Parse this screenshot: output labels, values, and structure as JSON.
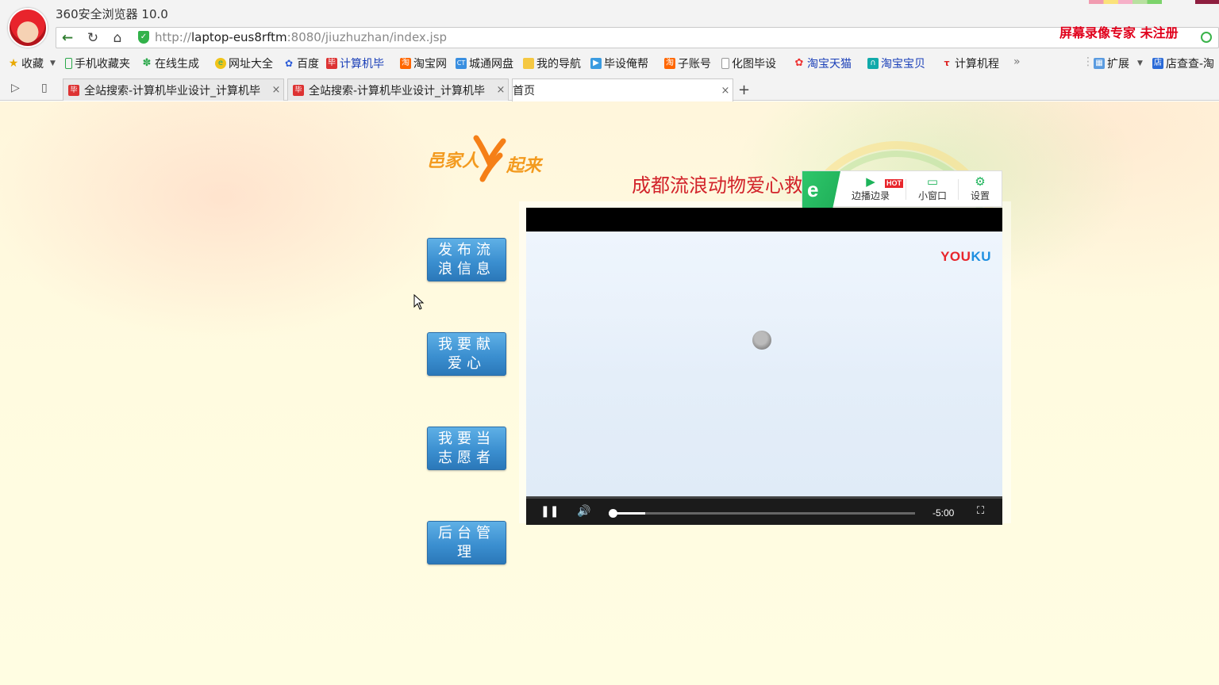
{
  "browser": {
    "app_title": "360安全浏览器 10.0",
    "url_prefix": "http://",
    "url_host": "laptop-eus8rftm",
    "url_path": ":8080/jiuzhuzhan/index.jsp",
    "recorder_text": "屏幕录像专家 未注册"
  },
  "bookmarks": [
    {
      "label": "收藏",
      "icon": "star-icon"
    },
    {
      "label": "手机收藏夹",
      "icon": "phone-icon"
    },
    {
      "label": "在线生成",
      "icon": "gear-icon"
    },
    {
      "label": "网址大全",
      "icon": "globe-icon"
    },
    {
      "label": "百度",
      "icon": "baidu-icon"
    },
    {
      "label": "计算机毕",
      "icon": "bi-icon"
    },
    {
      "label": "淘宝网",
      "icon": "taobao-icon"
    },
    {
      "label": "城通网盘",
      "icon": "ct-icon"
    },
    {
      "label": "我的导航",
      "icon": "folder-icon"
    },
    {
      "label": "毕设俺帮",
      "icon": "tv-icon"
    },
    {
      "label": "子账号",
      "icon": "taobao-icon"
    },
    {
      "label": "化图毕设",
      "icon": "page-icon"
    },
    {
      "label": "淘宝天猫",
      "icon": "tmall-icon"
    },
    {
      "label": "淘宝宝贝",
      "icon": "bag-icon"
    },
    {
      "label": "计算机程",
      "icon": "hot-icon"
    },
    {
      "label": "扩展",
      "icon": "extension-icon"
    },
    {
      "label": "店查查-淘",
      "icon": "shop-icon"
    }
  ],
  "tabs": [
    {
      "label": "全站搜索-计算机毕业设计_计算机毕"
    },
    {
      "label": "全站搜索-计算机毕业设计_计算机毕"
    },
    {
      "label": "首页"
    }
  ],
  "page": {
    "logo_text_1": "邑家人",
    "logo_text_2": "起来",
    "title": "成都流浪动物爱心救",
    "buttons": [
      {
        "line1": "发布流",
        "line2": "浪信息"
      },
      {
        "line1": "我要献",
        "line2": "爱心"
      },
      {
        "line1": "我要当",
        "line2": "志愿者"
      },
      {
        "line1": "后台管",
        "line2": "理"
      }
    ]
  },
  "video": {
    "brand_part1": "YOU",
    "brand_part2": "KU",
    "time_remaining": "-5:00",
    "progress": 0.12
  },
  "ext_toolbar": {
    "items": [
      {
        "label": "边播边录",
        "badge": "HOT"
      },
      {
        "label": "小窗口"
      },
      {
        "label": "设置"
      }
    ]
  }
}
